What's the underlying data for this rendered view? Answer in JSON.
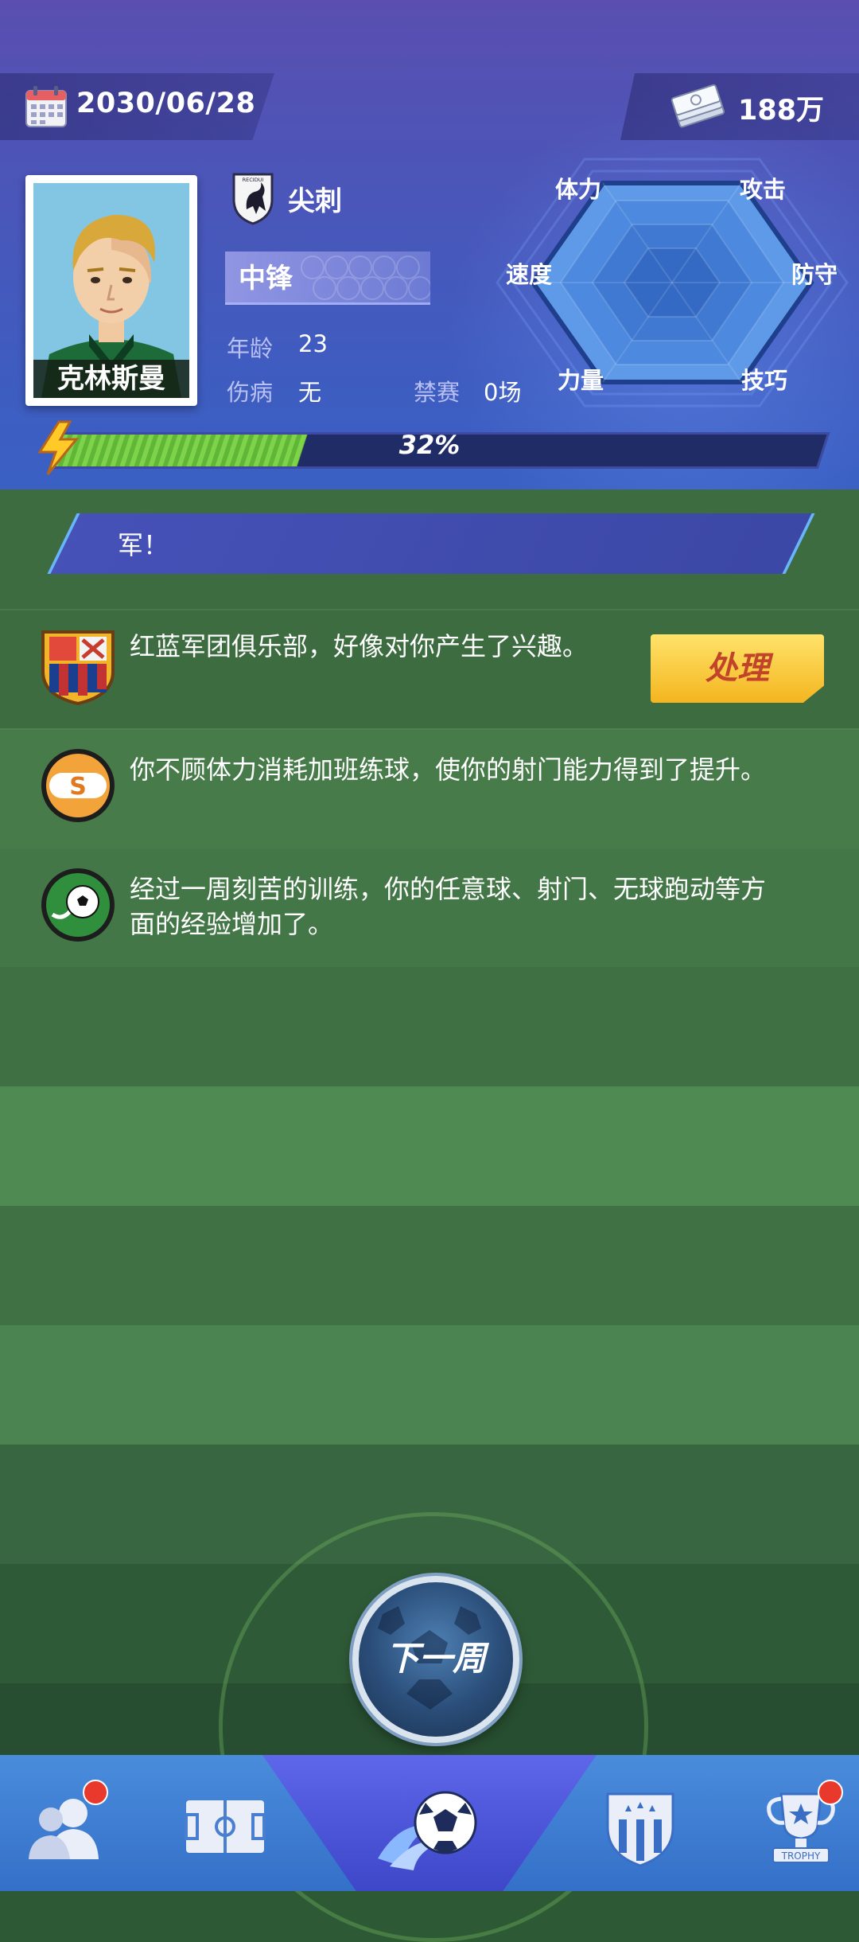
{
  "header": {
    "date": "2030/06/28",
    "money": "188万",
    "player": {
      "name": "克林斯曼",
      "team": "尖刺",
      "team_crest_text": "RECIDUI",
      "position": "中锋",
      "age_label": "年龄",
      "age": "23",
      "injury_label": "伤病",
      "injury": "无",
      "ban_label": "禁赛",
      "ban": "0场"
    },
    "stats": {
      "stamina": "体力",
      "attack": "攻击",
      "speed": "速度",
      "defense": "防守",
      "power": "力量",
      "technique": "技巧"
    },
    "energy": {
      "percent_text": "32%",
      "value": 0.32
    }
  },
  "field": {
    "banner_text": "军！",
    "messages": [
      {
        "icon": "club-crest-icon",
        "text": "红蓝军团俱乐部，好像对你产生了兴趣。"
      },
      {
        "icon": "s-coin-icon",
        "text": "你不顾体力消耗加班练球，使你的射门能力得到了提升。"
      },
      {
        "icon": "football-icon",
        "text": "经过一周刻苦的训练，你的任意球、射门、无球跑动等方面的经验增加了。"
      }
    ],
    "action_label": "处理",
    "next_week_label": "下一周"
  },
  "nav": {
    "items": [
      "players-icon",
      "pitch-icon",
      "match-icon",
      "club-badge-icon",
      "trophy-icon"
    ],
    "trophy_text": "TROPHY"
  },
  "colors": {
    "header": "#4c55b8",
    "field_light": "#4f8a52",
    "field_dark": "#3d7042",
    "accent_gold": "#f4b51f",
    "badge_red": "#e8392c"
  }
}
